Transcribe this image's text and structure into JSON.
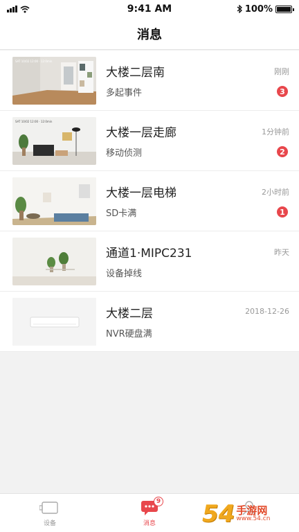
{
  "status_bar": {
    "time": "9:41 AM",
    "battery": "100%",
    "icons": [
      "signal-icon",
      "wifi-icon",
      "bluetooth-icon",
      "battery-icon"
    ]
  },
  "header": {
    "title": "消息"
  },
  "messages": [
    {
      "title": "大楼二层南",
      "subtitle": "多起事件",
      "time": "刚刚",
      "badge": "3",
      "thumb_overlay": "SAT 10/02 12:00 · 12:0min"
    },
    {
      "title": "大楼一层走廊",
      "subtitle": "移动侦测",
      "time": "1分钟前",
      "badge": "2",
      "thumb_overlay": "SAT 10/02 12:00 · 12:0min"
    },
    {
      "title": "大楼一层电梯",
      "subtitle": "SD卡满",
      "time": "2小时前",
      "badge": "1"
    },
    {
      "title": "通道1·MIPC231",
      "subtitle": "设备掉线",
      "time": "昨天"
    },
    {
      "title": "大楼二层",
      "subtitle": "NVR硬盘满",
      "time": "2018-12-26"
    }
  ],
  "tab_bar": {
    "tabs": [
      {
        "label": "设备",
        "icon": "camera-icon",
        "active": false
      },
      {
        "label": "消息",
        "icon": "message-icon",
        "active": true,
        "badge": "9"
      },
      {
        "label": "",
        "icon": "profile-icon",
        "active": false
      }
    ]
  },
  "watermark": {
    "number": "54",
    "text": "手游网",
    "url": "www.54.cn"
  },
  "colors": {
    "accent": "#e8474c",
    "background": "#f2f2f2",
    "watermark_orange": "#f0a81e"
  }
}
